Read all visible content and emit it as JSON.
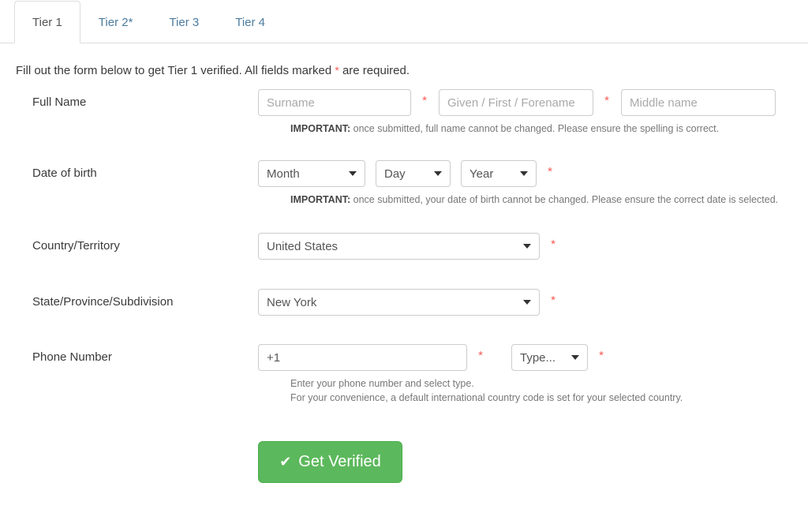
{
  "tabs": [
    {
      "label": "Tier 1",
      "active": true
    },
    {
      "label": "Tier 2*",
      "active": false
    },
    {
      "label": "Tier 3",
      "active": false
    },
    {
      "label": "Tier 4",
      "active": false
    }
  ],
  "intro": {
    "before_star": "Fill out the form below to get Tier 1 verified. All fields marked ",
    "star": "*",
    "after_star": " are required."
  },
  "form": {
    "full_name": {
      "label": "Full Name",
      "surname_placeholder": "Surname",
      "given_placeholder": "Given / First / Forename",
      "middle_placeholder": "Middle name",
      "surname_value": "",
      "given_value": "",
      "middle_value": "",
      "required_marker": "*",
      "help_bold": "IMPORTANT:",
      "help_text": " once submitted, full name cannot be changed. Please ensure the spelling is correct."
    },
    "date_of_birth": {
      "label": "Date of birth",
      "month_value": "Month",
      "day_value": "Day",
      "year_value": "Year",
      "required_marker": "*",
      "help_bold": "IMPORTANT:",
      "help_text": " once submitted, your date of birth cannot be changed. Please ensure the correct date is selected."
    },
    "country": {
      "label": "Country/Territory",
      "value": "United States",
      "required_marker": "*"
    },
    "state": {
      "label": "State/Province/Subdivision",
      "value": "New York",
      "required_marker": "*"
    },
    "phone": {
      "label": "Phone Number",
      "number_value": "+1",
      "number_placeholder": "",
      "type_value": "Type...",
      "required_marker": "*",
      "type_required_marker": "*",
      "help_line1": "Enter your phone number and select type.",
      "help_line2": "For your convenience, a default international country code is set for your selected country."
    }
  },
  "submit": {
    "label": "Get Verified",
    "icon": "check-icon",
    "color": "#5cb85c"
  }
}
